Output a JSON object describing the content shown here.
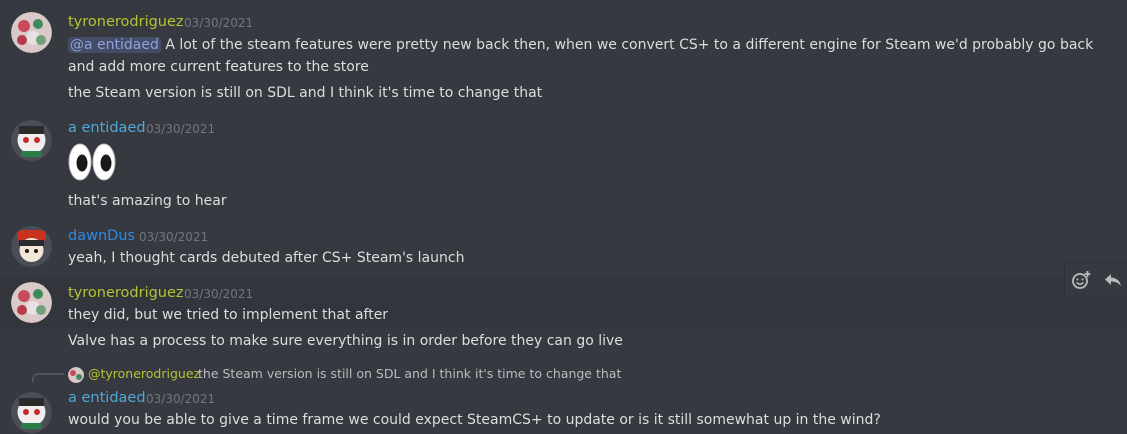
{
  "colors": {
    "tyrone": "#b5c334",
    "entidaed": "#4fa8d8",
    "dawn": "#2b8be6",
    "background": "#36393f"
  },
  "messages": [
    {
      "author": "tyronerodriguez",
      "timestamp": "03/30/2021",
      "mention": "@a entidaed",
      "lines": [
        "A lot of the steam features were pretty new back then, when we convert CS+ to a different engine for Steam we'd probably go back and add more current features to the store",
        "the Steam version is still on SDL and I think it's time to change that"
      ]
    },
    {
      "author": "a entidaed",
      "timestamp": "03/30/2021",
      "emoji": "eyes",
      "lines": [
        "that's amazing to hear"
      ]
    },
    {
      "author": "dawnDus",
      "timestamp": "03/30/2021",
      "lines": [
        "yeah, I thought cards debuted after CS+ Steam's launch"
      ]
    },
    {
      "author": "tyronerodriguez",
      "timestamp": "03/30/2021",
      "lines": [
        "they did, but we tried to implement that after",
        "Valve has a process to make sure everything is in order before they can go live"
      ]
    },
    {
      "author": "a entidaed",
      "timestamp": "03/30/2021",
      "reply": {
        "author": "@tyronerodriguez",
        "text": "the Steam version is still on SDL and I think it's time to change that"
      },
      "lines": [
        "would you be able to give a time frame we could expect SteamCS+ to update or is it still somewhat up in the wind?"
      ]
    }
  ],
  "toolbar": {
    "icons": [
      "add-reaction-icon",
      "reply-icon"
    ]
  }
}
